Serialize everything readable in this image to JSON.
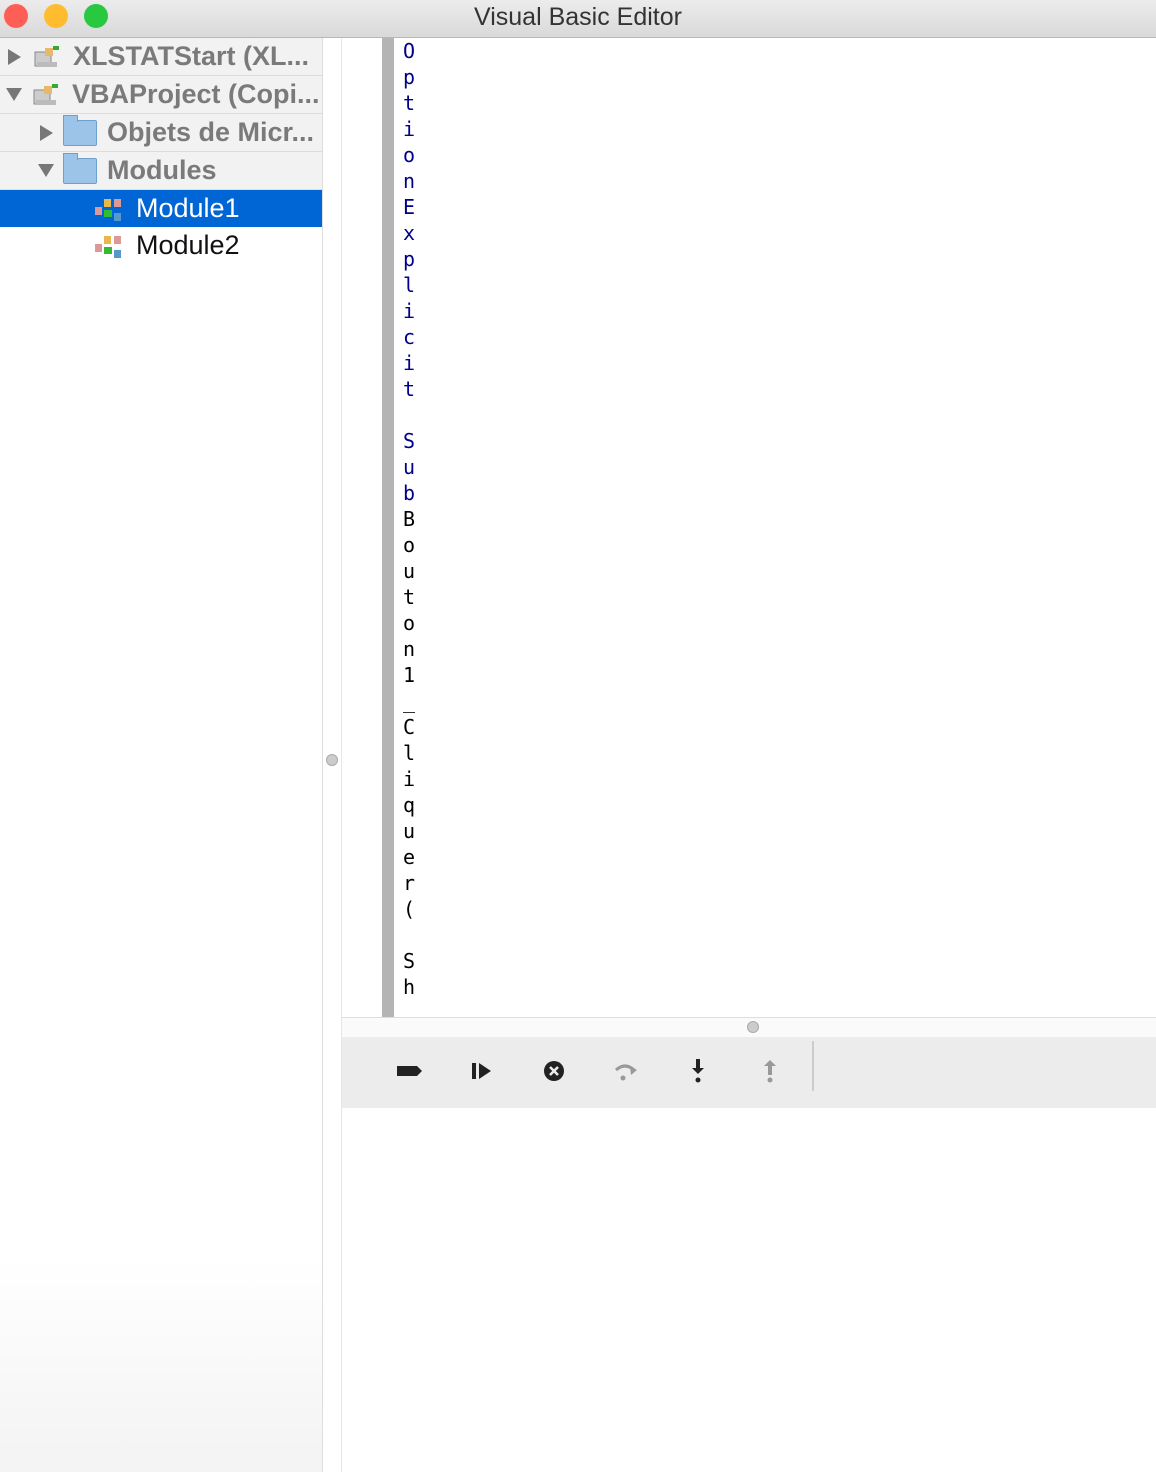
{
  "window": {
    "title": "Visual Basic Editor"
  },
  "colors": {
    "close": "#fd5f57",
    "minimize": "#febc2e",
    "zoom": "#28c840",
    "selection": "#0066d6",
    "keyword": "#00008c"
  },
  "tree": {
    "items": [
      {
        "label": "XLSTATStart (XL...",
        "icon": "vba-project-icon"
      },
      {
        "label": "VBAProject (Copi...",
        "icon": "vba-project-icon"
      },
      {
        "label": "Objets de Micr...",
        "icon": "folder-icon"
      },
      {
        "label": "Modules",
        "icon": "folder-icon"
      },
      {
        "label": "Module1",
        "icon": "module-icon"
      },
      {
        "label": "Module2",
        "icon": "module-icon"
      }
    ]
  },
  "code": {
    "line1": "Option Explicit",
    "line3_kw": "Sub",
    "line3_rest": "Bouton1_Cliquer()",
    "line5": "Sh"
  },
  "toolbar": {
    "buttons": [
      "toggle-breakpoint",
      "run",
      "stop",
      "step-over",
      "step-into",
      "step-out"
    ]
  }
}
